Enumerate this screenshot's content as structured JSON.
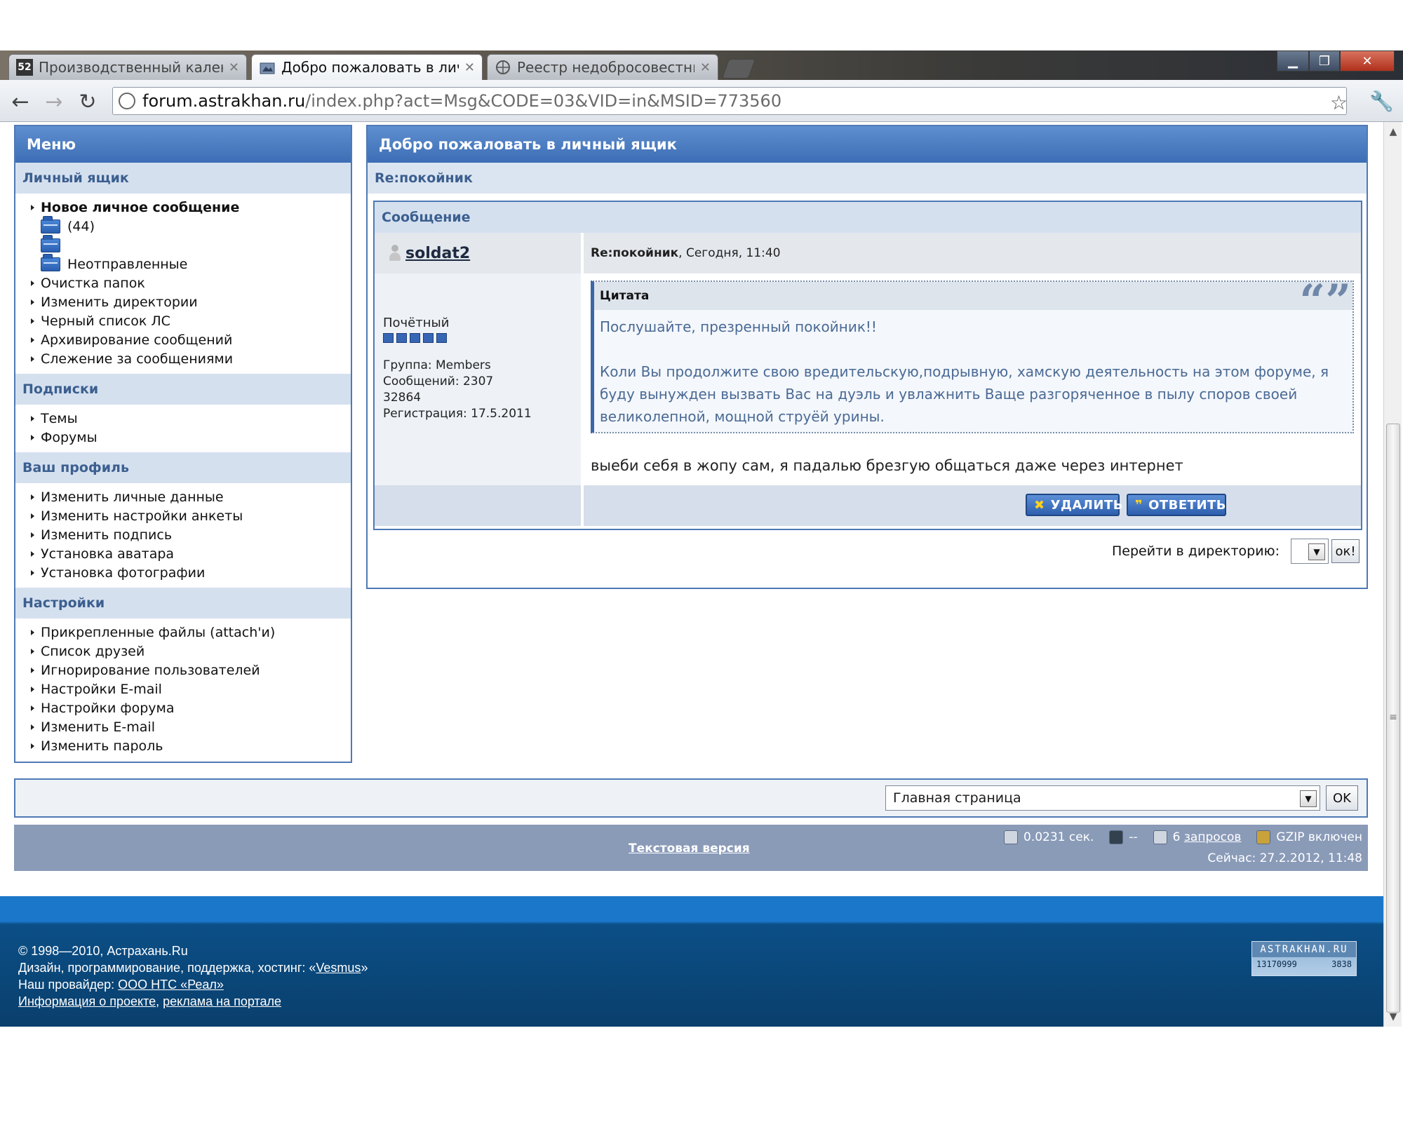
{
  "browser": {
    "tabs": [
      {
        "title": "Производственный календ",
        "favicon": "52"
      },
      {
        "title": "Добро пожаловать в личн",
        "favicon": "forum-icon"
      },
      {
        "title": "Реестр недобросовестных",
        "favicon": "globe-icon"
      }
    ],
    "url_host": "forum.astrakhan.ru",
    "url_path": "/index.php?act=Msg&CODE=03&VID=in&MSID=773560"
  },
  "menu": {
    "title": "Меню",
    "sections": [
      {
        "heading": "Личный ящик",
        "new_message": "Новое личное сообщение",
        "inbox_count": "(44)",
        "unsent": "Неотправленные",
        "items": [
          "Очистка папок",
          "Изменить директории",
          "Черный список ЛС",
          "Архивирование сообщений",
          "Слежение за сообщениями"
        ]
      },
      {
        "heading": "Подписки",
        "items": [
          "Темы",
          "Форумы"
        ]
      },
      {
        "heading": "Ваш профиль",
        "items": [
          "Изменить личные данные",
          "Изменить настройки анкеты",
          "Изменить подпись",
          "Установка аватара",
          "Установка фотографии"
        ]
      },
      {
        "heading": "Настройки",
        "items": [
          "Прикрепленные файлы (attach'и)",
          "Список друзей",
          "Игнорирование пользователей",
          "Настройки E-mail",
          "Настройки форума",
          "Изменить E-mail",
          "Изменить пароль"
        ]
      }
    ]
  },
  "main": {
    "title": "Добро пожаловать в личный ящик",
    "topic": "Re:покойник",
    "message_header": "Сообщение",
    "author": {
      "name": "soldat2",
      "rank": "Почётный",
      "rank_pips": 5,
      "group": "Группа: Members",
      "posts": "Сообщений: 2307",
      "id": "32864",
      "registered": "Регистрация: 17.5.2011"
    },
    "meta_subject": "Re:покойник",
    "meta_time": ", Сегодня, 11:40",
    "quote": {
      "label": "Цитата",
      "line1": "Послушайте, презренный покойник!!",
      "line2": "Коли Вы продолжите свою вредительскую,подрывную, хамскую деятельность на этом форуме, я буду вынужден вызвать Вас на дуэль и увлажнить Ваще разгоряченное в пылу споров своей великолепной, мощной струёй урины."
    },
    "reply": "выеби себя в жопу сам, я падалью брезгую общаться даже через интернет",
    "delete_label": "УДАЛИТЬ",
    "reply_label": "ОТВЕТИТЬ",
    "goto_label": "Перейти в директорию:",
    "goto_ok": "ок!"
  },
  "quick_jump": {
    "selected": "Главная страница",
    "ok": "OK"
  },
  "stats": {
    "text_version": "Текстовая версия",
    "time": "0.0231 сек.",
    "dash": "--",
    "queries_prefix": "6 ",
    "queries_link": "запросов",
    "gzip": "GZIP включен",
    "now": "Сейчас: 27.2.2012, 11:48"
  },
  "site_footer": {
    "copyright": "© 1998—2010, Астрахань.Ru",
    "design_prefix": "Дизайн, программирование, поддержка, хостинг: «",
    "design_link": "Vesmus",
    "design_suffix": "»",
    "provider_prefix": "Наш провайдер: ",
    "provider_link": "ООО НТС «Реал»",
    "about_link": "Информация о проекте",
    "sep": ", ",
    "ads_link": "реклама на портале",
    "counter_title": "ASTRAKHAN.RU",
    "counter_a": "13170999",
    "counter_b": "3838"
  },
  "colors": {
    "accent": "#3d6db5",
    "subhead": "#d5e0ef",
    "footer_blue": "#0a3f6c"
  }
}
